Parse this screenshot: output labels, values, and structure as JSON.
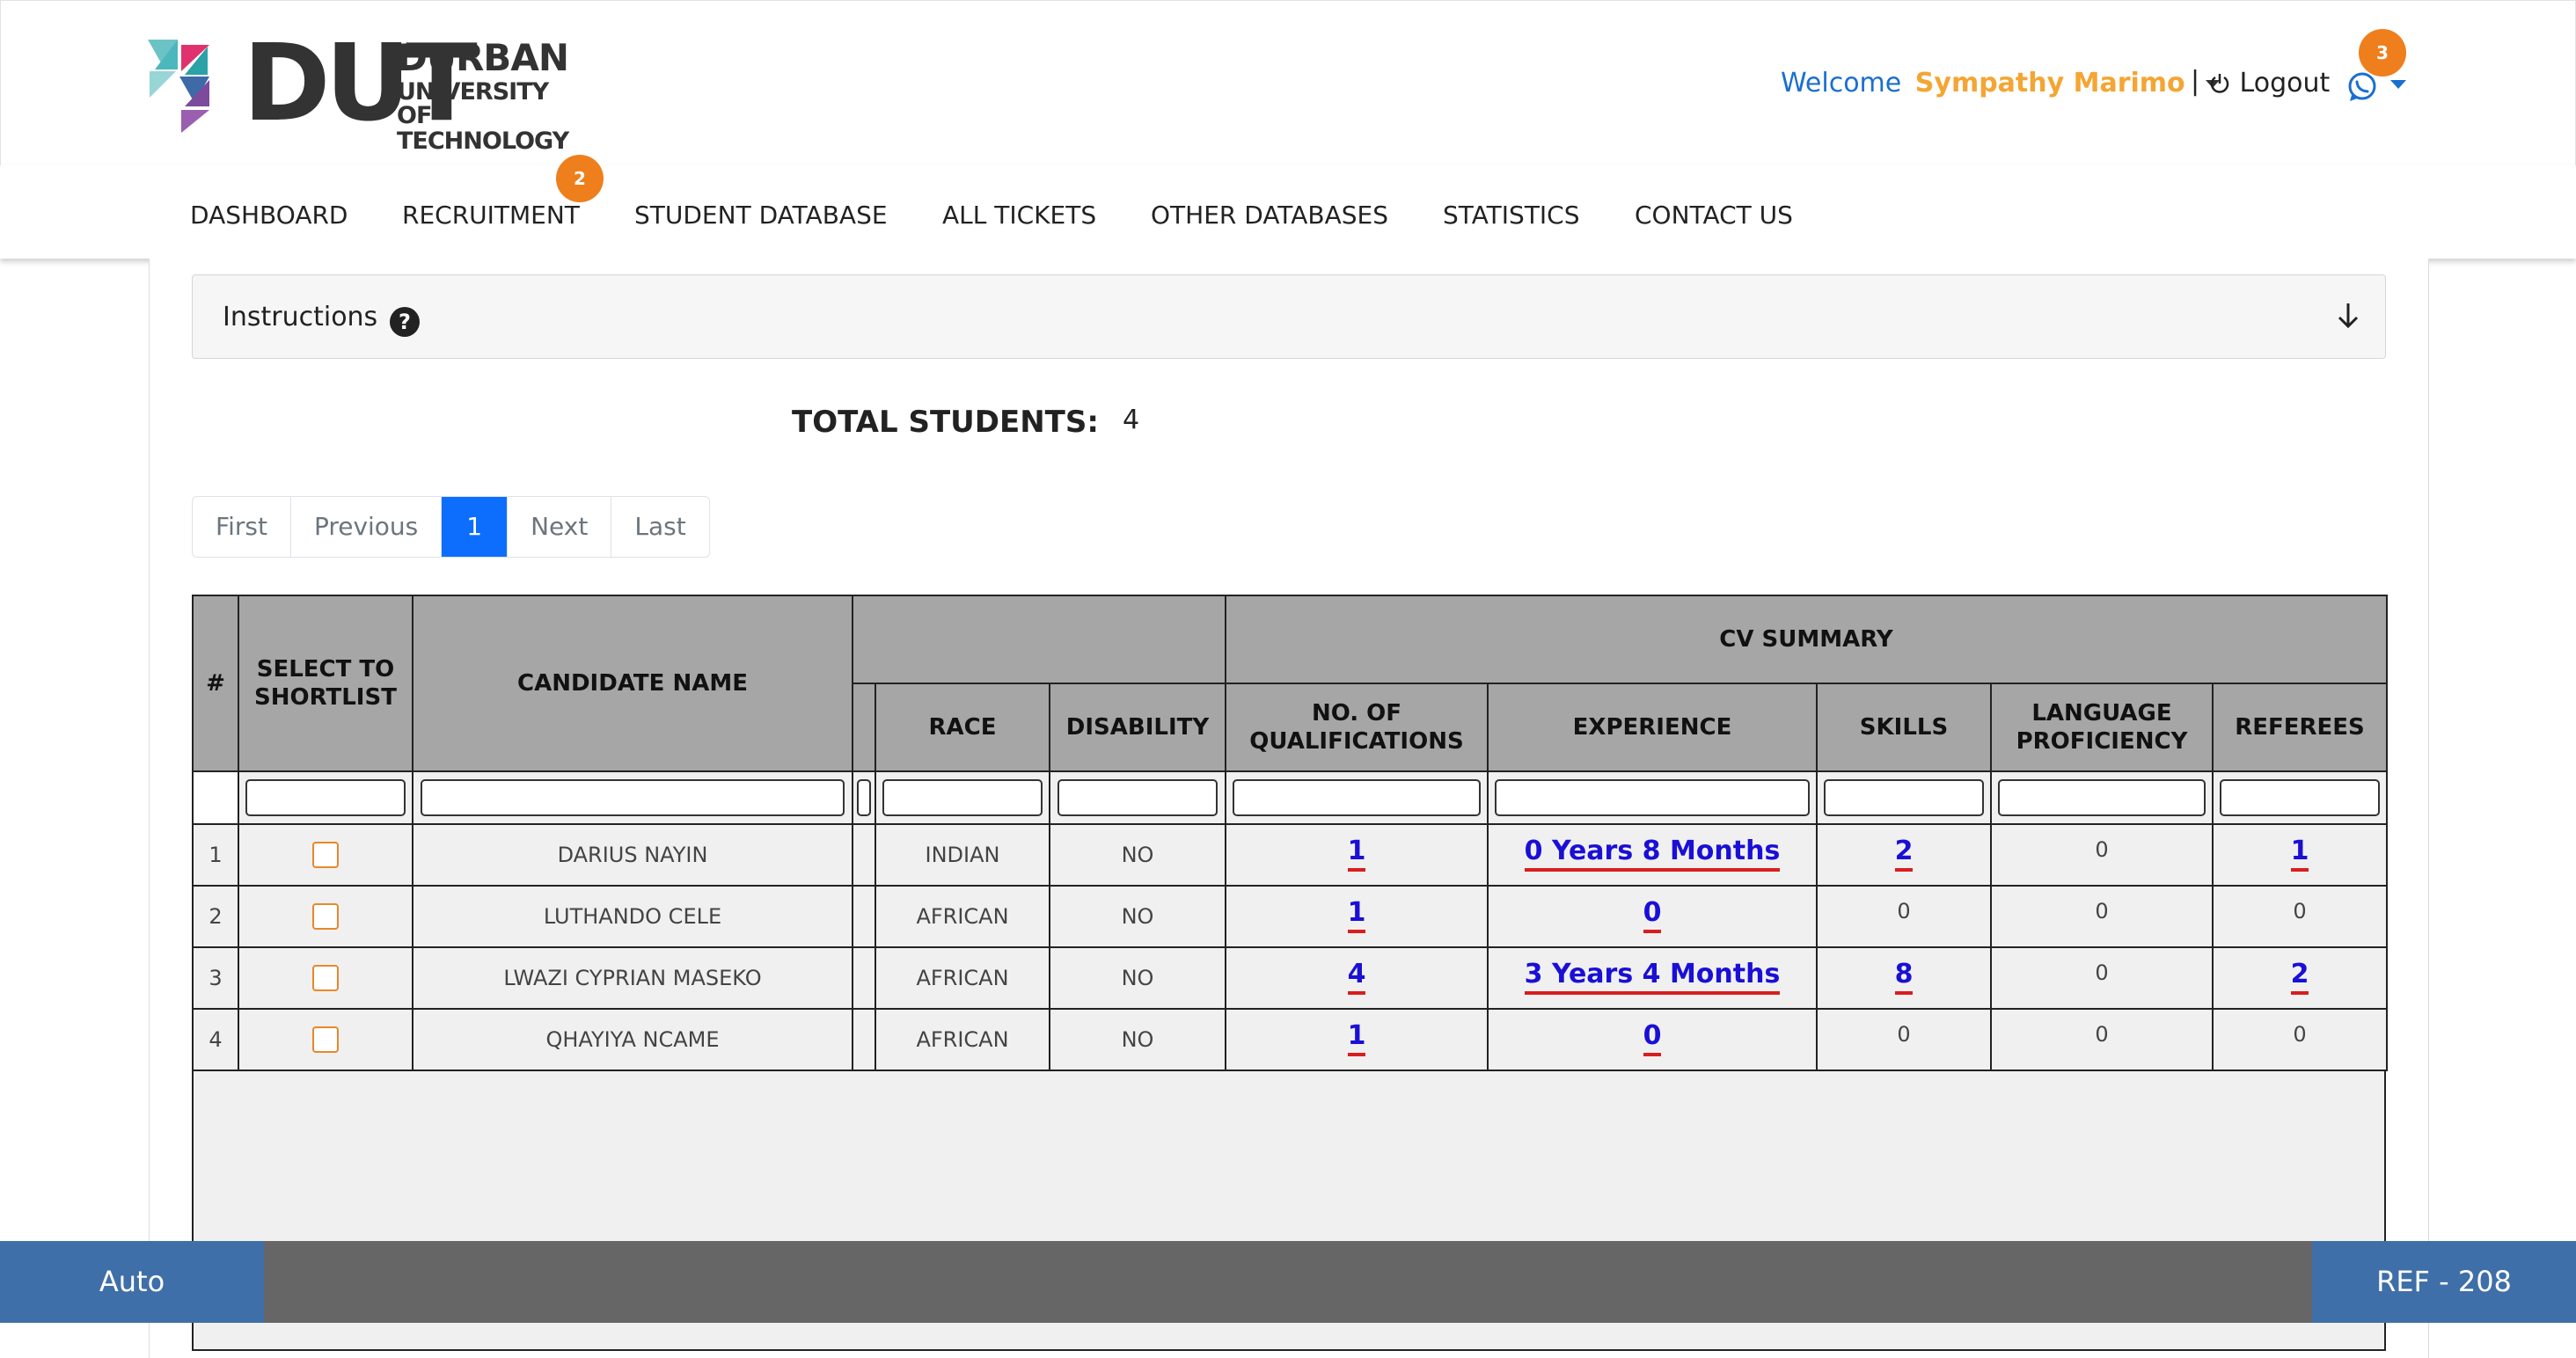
{
  "header": {
    "logo": {
      "word": "DUT",
      "line1": "DURBAN",
      "line2": "UNIVERSITY OF",
      "line3": "TECHNOLOGY"
    },
    "welcome_prefix": "Welcome",
    "user_name": "Sympathy Marimo",
    "separator": "|",
    "logout_label": "Logout",
    "whatsapp_badge": "3"
  },
  "nav": {
    "items": [
      {
        "label": "DASHBOARD"
      },
      {
        "label": "RECRUITMENT",
        "badge": "2"
      },
      {
        "label": "STUDENT DATABASE"
      },
      {
        "label": "ALL TICKETS"
      },
      {
        "label": "OTHER DATABASES"
      },
      {
        "label": "STATISTICS"
      },
      {
        "label": "CONTACT US"
      }
    ]
  },
  "instructions": {
    "label": "Instructions",
    "help_glyph": "?"
  },
  "totals": {
    "label": "TOTAL STUDENTS:",
    "value": "4"
  },
  "pagination": {
    "first": "First",
    "previous": "Previous",
    "current": "1",
    "next": "Next",
    "last": "Last"
  },
  "table": {
    "group_header": "CV SUMMARY",
    "headers": {
      "num": "#",
      "select": "SELECT TO SHORTLIST",
      "candidate": "CANDIDATE NAME",
      "race": "RACE",
      "disability": "DISABILITY",
      "qualifications": "NO. OF QUALIFICATIONS",
      "experience": "EXPERIENCE",
      "skills": "SKILLS",
      "language": "LANGUAGE PROFICIENCY",
      "referees": "REFEREES"
    },
    "rows": [
      {
        "num": "1",
        "name": "DARIUS NAYIN",
        "race": "INDIAN",
        "disability": "NO",
        "qualifications": "1",
        "experience": "0 Years 8 Months",
        "skills": "2",
        "language": "0",
        "referees": "1"
      },
      {
        "num": "2",
        "name": "LUTHANDO CELE",
        "race": "AFRICAN",
        "disability": "NO",
        "qualifications": "1",
        "experience": "0",
        "skills": "0",
        "language": "0",
        "referees": "0"
      },
      {
        "num": "3",
        "name": "LWAZI CYPRIAN MASEKO",
        "race": "AFRICAN",
        "disability": "NO",
        "qualifications": "4",
        "experience": "3 Years 4 Months",
        "skills": "8",
        "language": "0",
        "referees": "2"
      },
      {
        "num": "4",
        "name": "QHAYIYA NCAME",
        "race": "AFRICAN",
        "disability": "NO",
        "qualifications": "1",
        "experience": "0",
        "skills": "0",
        "language": "0",
        "referees": "0"
      }
    ]
  },
  "footer": {
    "left": "Auto",
    "right": "REF - 208"
  }
}
